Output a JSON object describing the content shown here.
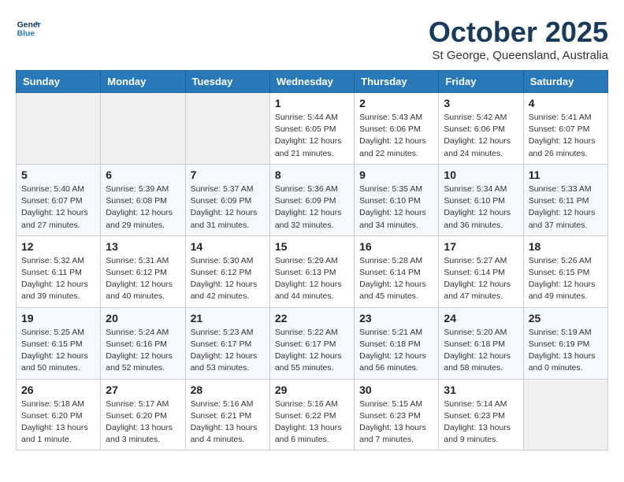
{
  "header": {
    "logo_line1": "General",
    "logo_line2": "Blue",
    "month": "October 2025",
    "location": "St George, Queensland, Australia"
  },
  "weekdays": [
    "Sunday",
    "Monday",
    "Tuesday",
    "Wednesday",
    "Thursday",
    "Friday",
    "Saturday"
  ],
  "weeks": [
    [
      {
        "day": "",
        "info": ""
      },
      {
        "day": "",
        "info": ""
      },
      {
        "day": "",
        "info": ""
      },
      {
        "day": "1",
        "info": "Sunrise: 5:44 AM\nSunset: 6:05 PM\nDaylight: 12 hours\nand 21 minutes."
      },
      {
        "day": "2",
        "info": "Sunrise: 5:43 AM\nSunset: 6:06 PM\nDaylight: 12 hours\nand 22 minutes."
      },
      {
        "day": "3",
        "info": "Sunrise: 5:42 AM\nSunset: 6:06 PM\nDaylight: 12 hours\nand 24 minutes."
      },
      {
        "day": "4",
        "info": "Sunrise: 5:41 AM\nSunset: 6:07 PM\nDaylight: 12 hours\nand 26 minutes."
      }
    ],
    [
      {
        "day": "5",
        "info": "Sunrise: 5:40 AM\nSunset: 6:07 PM\nDaylight: 12 hours\nand 27 minutes."
      },
      {
        "day": "6",
        "info": "Sunrise: 5:39 AM\nSunset: 6:08 PM\nDaylight: 12 hours\nand 29 minutes."
      },
      {
        "day": "7",
        "info": "Sunrise: 5:37 AM\nSunset: 6:09 PM\nDaylight: 12 hours\nand 31 minutes."
      },
      {
        "day": "8",
        "info": "Sunrise: 5:36 AM\nSunset: 6:09 PM\nDaylight: 12 hours\nand 32 minutes."
      },
      {
        "day": "9",
        "info": "Sunrise: 5:35 AM\nSunset: 6:10 PM\nDaylight: 12 hours\nand 34 minutes."
      },
      {
        "day": "10",
        "info": "Sunrise: 5:34 AM\nSunset: 6:10 PM\nDaylight: 12 hours\nand 36 minutes."
      },
      {
        "day": "11",
        "info": "Sunrise: 5:33 AM\nSunset: 6:11 PM\nDaylight: 12 hours\nand 37 minutes."
      }
    ],
    [
      {
        "day": "12",
        "info": "Sunrise: 5:32 AM\nSunset: 6:11 PM\nDaylight: 12 hours\nand 39 minutes."
      },
      {
        "day": "13",
        "info": "Sunrise: 5:31 AM\nSunset: 6:12 PM\nDaylight: 12 hours\nand 40 minutes."
      },
      {
        "day": "14",
        "info": "Sunrise: 5:30 AM\nSunset: 6:12 PM\nDaylight: 12 hours\nand 42 minutes."
      },
      {
        "day": "15",
        "info": "Sunrise: 5:29 AM\nSunset: 6:13 PM\nDaylight: 12 hours\nand 44 minutes."
      },
      {
        "day": "16",
        "info": "Sunrise: 5:28 AM\nSunset: 6:14 PM\nDaylight: 12 hours\nand 45 minutes."
      },
      {
        "day": "17",
        "info": "Sunrise: 5:27 AM\nSunset: 6:14 PM\nDaylight: 12 hours\nand 47 minutes."
      },
      {
        "day": "18",
        "info": "Sunrise: 5:26 AM\nSunset: 6:15 PM\nDaylight: 12 hours\nand 49 minutes."
      }
    ],
    [
      {
        "day": "19",
        "info": "Sunrise: 5:25 AM\nSunset: 6:15 PM\nDaylight: 12 hours\nand 50 minutes."
      },
      {
        "day": "20",
        "info": "Sunrise: 5:24 AM\nSunset: 6:16 PM\nDaylight: 12 hours\nand 52 minutes."
      },
      {
        "day": "21",
        "info": "Sunrise: 5:23 AM\nSunset: 6:17 PM\nDaylight: 12 hours\nand 53 minutes."
      },
      {
        "day": "22",
        "info": "Sunrise: 5:22 AM\nSunset: 6:17 PM\nDaylight: 12 hours\nand 55 minutes."
      },
      {
        "day": "23",
        "info": "Sunrise: 5:21 AM\nSunset: 6:18 PM\nDaylight: 12 hours\nand 56 minutes."
      },
      {
        "day": "24",
        "info": "Sunrise: 5:20 AM\nSunset: 6:18 PM\nDaylight: 12 hours\nand 58 minutes."
      },
      {
        "day": "25",
        "info": "Sunrise: 5:19 AM\nSunset: 6:19 PM\nDaylight: 13 hours\nand 0 minutes."
      }
    ],
    [
      {
        "day": "26",
        "info": "Sunrise: 5:18 AM\nSunset: 6:20 PM\nDaylight: 13 hours\nand 1 minute."
      },
      {
        "day": "27",
        "info": "Sunrise: 5:17 AM\nSunset: 6:20 PM\nDaylight: 13 hours\nand 3 minutes."
      },
      {
        "day": "28",
        "info": "Sunrise: 5:16 AM\nSunset: 6:21 PM\nDaylight: 13 hours\nand 4 minutes."
      },
      {
        "day": "29",
        "info": "Sunrise: 5:16 AM\nSunset: 6:22 PM\nDaylight: 13 hours\nand 6 minutes."
      },
      {
        "day": "30",
        "info": "Sunrise: 5:15 AM\nSunset: 6:23 PM\nDaylight: 13 hours\nand 7 minutes."
      },
      {
        "day": "31",
        "info": "Sunrise: 5:14 AM\nSunset: 6:23 PM\nDaylight: 13 hours\nand 9 minutes."
      },
      {
        "day": "",
        "info": ""
      }
    ]
  ]
}
